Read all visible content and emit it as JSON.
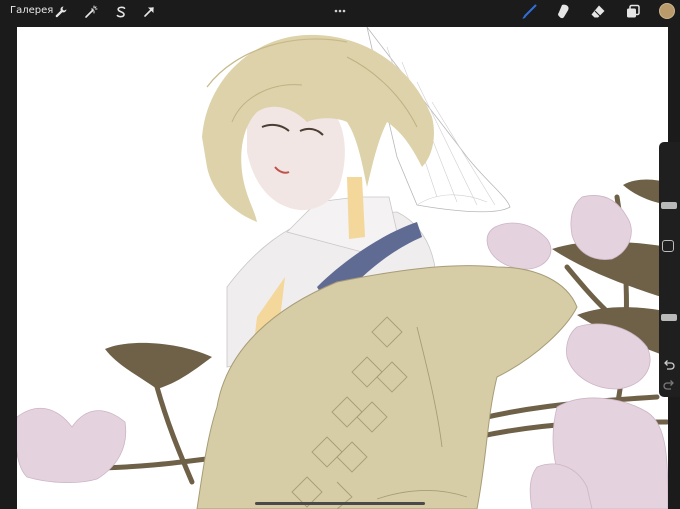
{
  "topbar": {
    "gallery_label": "Галерея"
  },
  "toolbar_icons": {
    "left": [
      "wrench-icon",
      "magic-wand-icon",
      "selection-s-icon",
      "arrow-transform-icon"
    ],
    "center": "more-dots-icon",
    "right": [
      "brush-icon",
      "smudge-icon",
      "eraser-icon",
      "layers-icon",
      "color-swatch"
    ]
  },
  "colors": {
    "ui_background": "#1b1b1b",
    "active_tool": "#2f6fd6",
    "current_color": "#b89a6b",
    "canvas": "#ffffff"
  },
  "sidebar": {
    "brush_size_percent": 34,
    "opacity_percent": 75
  }
}
